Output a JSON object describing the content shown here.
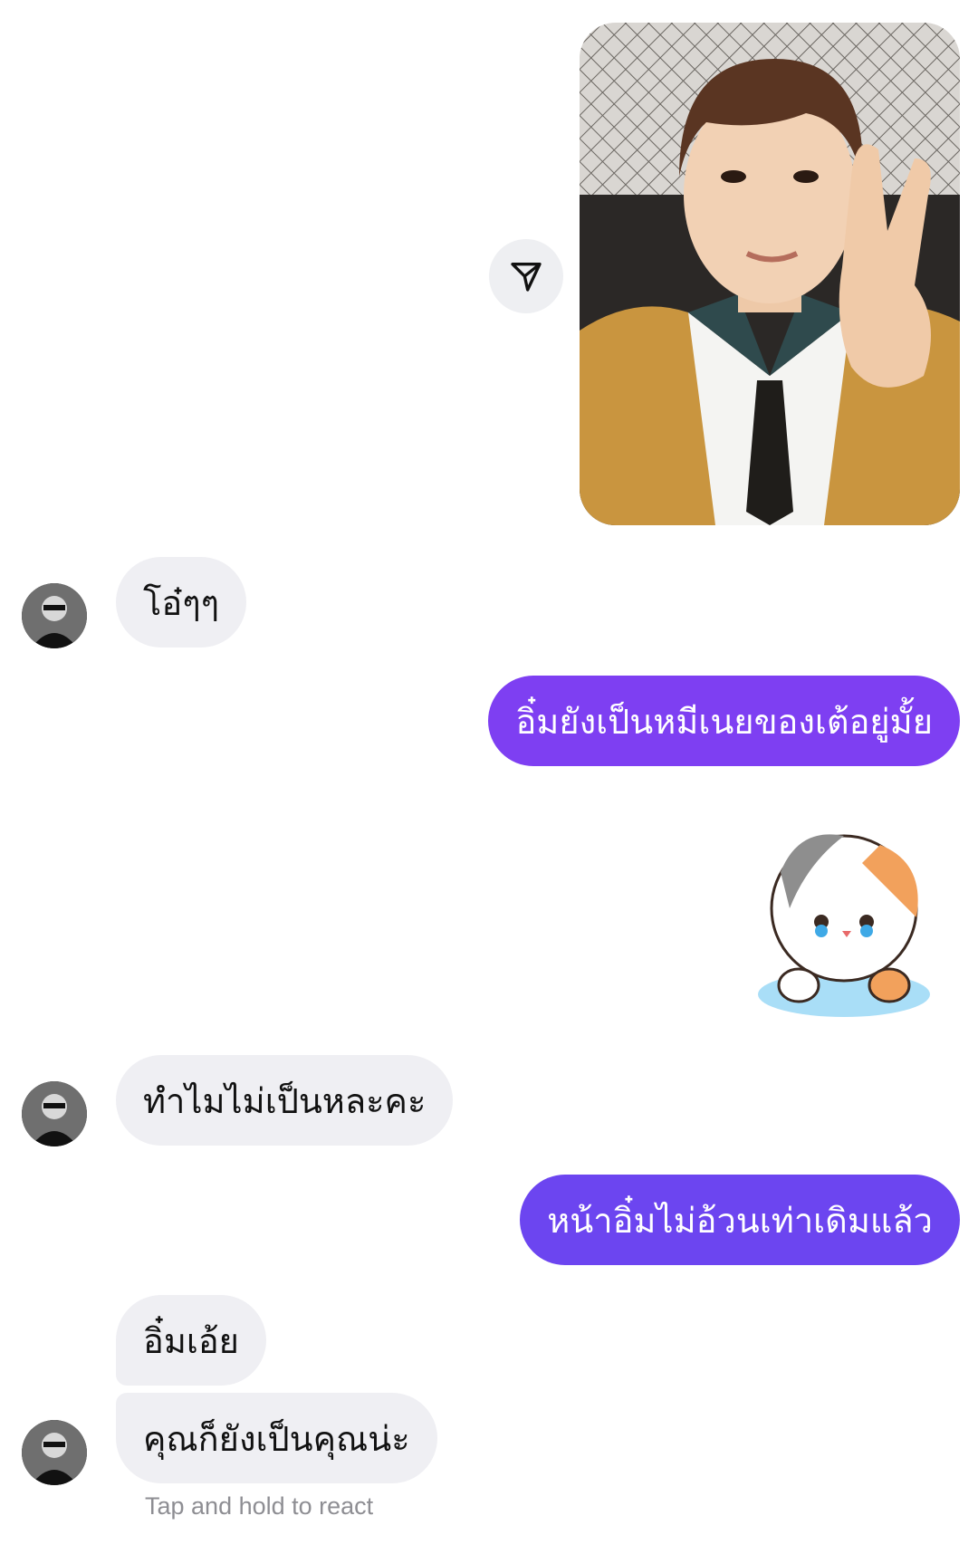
{
  "messages": {
    "msg1": "โอ๋ๆๆ",
    "msg2": "อิ๋มยังเป็นหมีเนยของเต้อยู่มั้ย",
    "msg3": "ทำไมไม่เป็นหละคะ",
    "msg4": "หน้าอิ๋มไม่อ้วนเท่าเดิมแล้ว",
    "msg5": "อิ๋มเอ้ย",
    "msg6": "คุณก็ยังเป็นคุณน่ะ"
  },
  "hint": "Tap and hold to react",
  "colors": {
    "outgoing_bubble": "#7e3ff2",
    "incoming_bubble": "#efeff3",
    "hint_text": "#8e8e93"
  },
  "icons": {
    "share": "paper-plane-icon"
  }
}
